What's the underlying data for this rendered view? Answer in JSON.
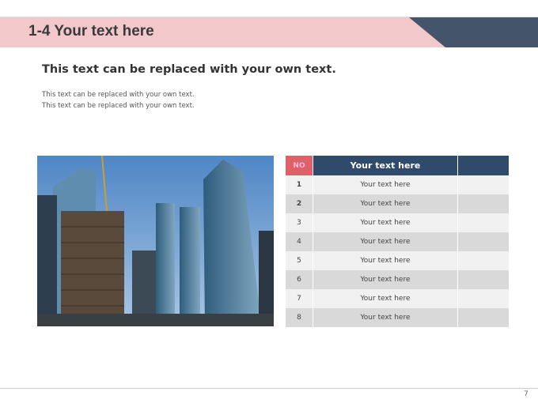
{
  "header": {
    "title": "1-4 Your text here",
    "colors": {
      "pink": "#f2c8cb",
      "navy": "#44546a"
    }
  },
  "content": {
    "subtitle": "This text can be replaced with your own text.",
    "lines": [
      "This text can be replaced with your own text.",
      "This text can be replaced with your own text."
    ]
  },
  "photo": {
    "subject": "building-photo"
  },
  "table": {
    "headers": [
      "NO",
      "Your text here",
      ""
    ],
    "rows": [
      {
        "no": "1",
        "text": "Your text here"
      },
      {
        "no": "2",
        "text": "Your text here"
      },
      {
        "no": "3",
        "text": "Your text here"
      },
      {
        "no": "4",
        "text": "Your text here"
      },
      {
        "no": "5",
        "text": "Your text here"
      },
      {
        "no": "6",
        "text": "Your text here"
      },
      {
        "no": "7",
        "text": "Your text here"
      },
      {
        "no": "8",
        "text": "Your text here"
      }
    ]
  },
  "footer": {
    "page": "7"
  }
}
